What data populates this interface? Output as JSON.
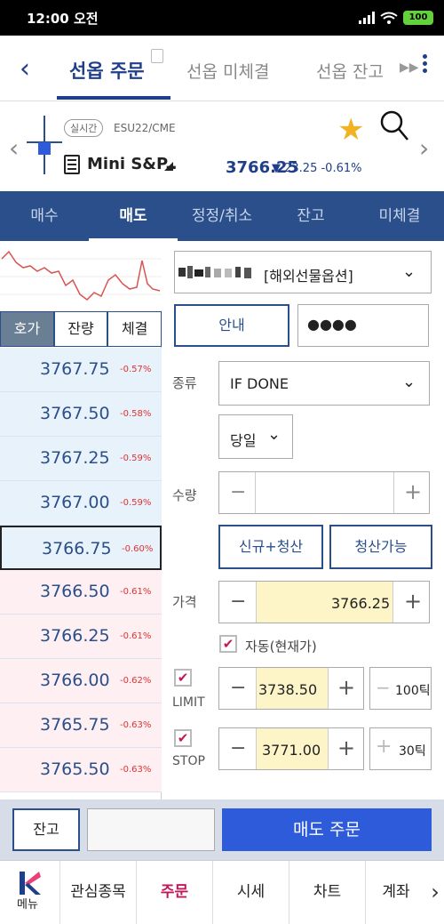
{
  "status": {
    "time": "12:00 오전",
    "battery": "100"
  },
  "header": {
    "tabs": [
      "선옵 주문",
      "선옵 미체결",
      "선옵 잔고"
    ]
  },
  "instrument": {
    "badge": "실시간",
    "symbol": "ESU22/CME",
    "name": "Mini S&P..",
    "price": "3766.25",
    "change": "▼ 23.25 -0.61%"
  },
  "order_tabs": [
    "매수",
    "매도",
    "정정/취소",
    "잔고",
    "미체결"
  ],
  "sub_tabs": [
    "호가",
    "잔량",
    "체결"
  ],
  "quotes": [
    {
      "price": "3767.75",
      "pct": "-0.57%"
    },
    {
      "price": "3767.50",
      "pct": "-0.58%"
    },
    {
      "price": "3767.25",
      "pct": "-0.59%"
    },
    {
      "price": "3767.00",
      "pct": "-0.59%"
    },
    {
      "price": "3766.75",
      "pct": "-0.60%"
    },
    {
      "price": "3766.50",
      "pct": "-0.61%"
    },
    {
      "price": "3766.25",
      "pct": "-0.61%"
    },
    {
      "price": "3766.00",
      "pct": "-0.62%"
    },
    {
      "price": "3765.75",
      "pct": "-0.63%"
    },
    {
      "price": "3765.50",
      "pct": "-0.63%"
    }
  ],
  "form": {
    "account": "[해외선물옵션]",
    "guide_btn": "안내",
    "password": "●●●●",
    "type_label": "종류",
    "type_value": "IF DONE",
    "period": "당일",
    "qty_label": "수량",
    "new_close_btn": "신규+청산",
    "closeable_btn": "청산가능",
    "price_label": "가격",
    "price_value": "3766.25",
    "auto_label": "자동(현재가)",
    "limit_label": "LIMIT",
    "limit_value": "3738.50",
    "limit_tick": "100틱",
    "stop_label": "STOP",
    "stop_value": "3771.00",
    "stop_tick": "30틱"
  },
  "bottom": {
    "balance_btn": "잔고",
    "sell_btn": "매도 주문"
  },
  "nav": {
    "menu": "메뉴",
    "items": [
      "관심종목",
      "주문",
      "시세",
      "차트",
      "계좌"
    ]
  },
  "colors": {
    "accent": "#2a4f8a",
    "sell": "#2e5bd9",
    "active_nav": "#c2185b"
  }
}
